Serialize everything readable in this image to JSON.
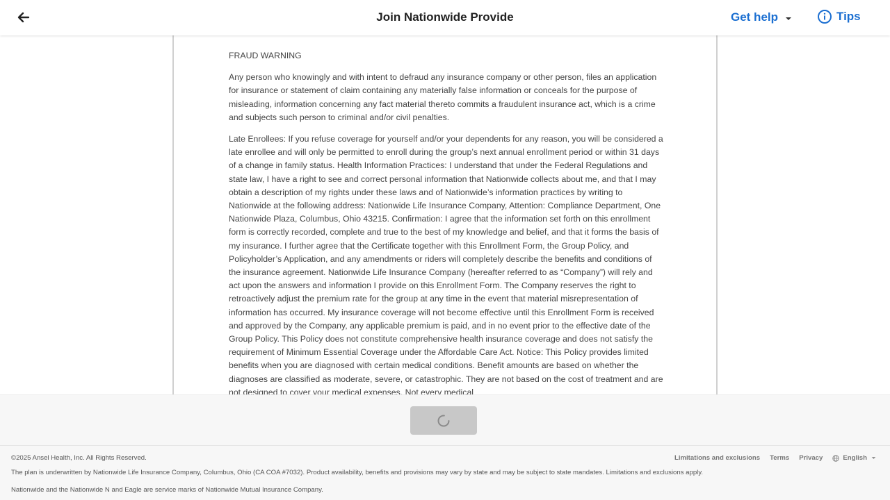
{
  "header": {
    "title": "Join Nationwide Provide",
    "get_help_label": "Get help",
    "tips_label": "Tips"
  },
  "document": {
    "heading": "FRAUD WARNING",
    "paragraph1": "Any person who knowingly and with intent to defraud any insurance company or other person, files an application for insurance or statement of claim containing any materially false information or conceals for the purpose of misleading, information concerning any fact material thereto commits a fraudulent insurance act, which is a crime and subjects such person to criminal and/or civil penalties.",
    "paragraph2": "Late Enrollees: If you refuse coverage for yourself and/or your dependents for any reason, you will be considered a late enrollee and will only be permitted to enroll during the group’s next annual enrollment period or within 31 days of a change in family status. Health Information Practices: I understand that under the Federal Regulations and state law, I have a right to see and correct personal information that Nationwide collects about me, and that I may obtain a description of my rights under these laws and of Nationwide’s information practices by writing to Nationwide at the following address: Nationwide Life Insurance Company, Attention: Compliance Department, One Nationwide Plaza, Columbus, Ohio 43215. Confirmation: I agree that the information set forth on this enrollment form is correctly recorded, complete and true to the best of my knowledge and belief, and that it forms the basis of my insurance. I further agree that the Certificate together with this Enrollment Form, the Group Policy, and Policyholder’s Application, and any amendments or riders will completely describe the benefits and conditions of the insurance agreement. Nationwide Life Insurance Company (hereafter referred to as “Company”) will rely and act upon the answers and information I provide on this Enrollment Form. The Company reserves the right to retroactively adjust the premium rate for the group at any time in the event that material misrepresentation of information has occurred. My insurance coverage will not become effective until this Enrollment Form is received and approved by the Company, any applicable premium is paid, and in no event prior to the effective date of the Group Policy. This Policy does not constitute comprehensive health insurance coverage and does not satisfy the requirement of Minimum Essential Coverage under the Affordable Care Act. Notice: This Policy provides limited benefits when you are diagnosed with certain medical conditions. Benefit amounts are based on whether the diagnoses are classified as moderate, severe, or catastrophic. They are not based on the cost of treatment and are not designed to cover your medical expenses. Not every medical"
  },
  "footer": {
    "copyright": "©2025 Ansel Health, Inc. All Rights Reserved.",
    "disclaimer1": "The plan is underwritten by Nationwide Life Insurance Company, Columbus, Ohio (CA COA #7032). Product availability, benefits and provisions may vary by state and may be subject to state mandates. Limitations and exclusions apply.",
    "disclaimer2": "Nationwide and the Nationwide N and Eagle are service marks of Nationwide Mutual Insurance Company.",
    "links": {
      "limitations": "Limitations and exclusions",
      "terms": "Terms",
      "privacy": "Privacy",
      "language": "English"
    }
  },
  "colors": {
    "accent": "#1c6fd1",
    "button_disabled": "#c8c8c8",
    "footer_bg": "#f7f7f7"
  },
  "icons": {
    "back": "arrow-left-icon",
    "help_caret": "chevron-down-icon",
    "tips": "info-circle-icon",
    "spinner": "loading-spinner-icon",
    "language": "globe-icon"
  }
}
